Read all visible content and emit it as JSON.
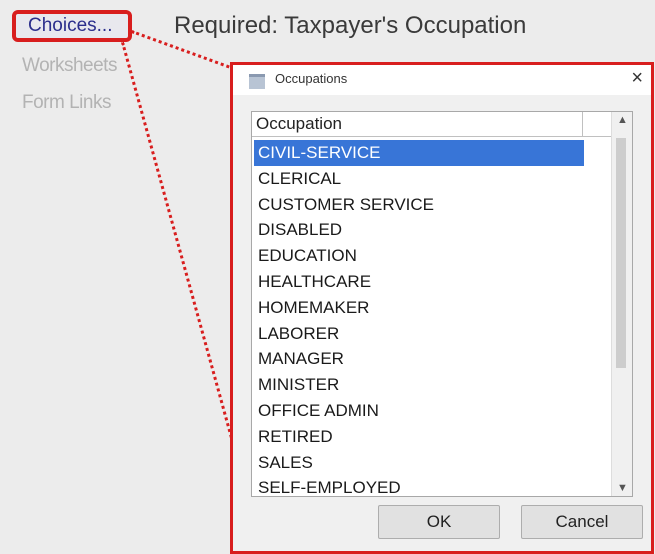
{
  "left_panel": {
    "choices_label": "Choices...",
    "worksheets_label": "Worksheets",
    "form_links_label": "Form Links"
  },
  "header": {
    "title": "Required: Taxpayer's Occupation"
  },
  "dialog": {
    "title": "Occupations",
    "close_glyph": "×",
    "column_header": "Occupation",
    "items": [
      "CIVIL-SERVICE",
      "CLERICAL",
      "CUSTOMER SERVICE",
      "DISABLED",
      "EDUCATION",
      "HEALTHCARE",
      "HOMEMAKER",
      "LABORER",
      "MANAGER",
      "MINISTER",
      "OFFICE ADMIN",
      "RETIRED",
      "SALES",
      "SELF-EMPLOYED"
    ],
    "selected_index": 0,
    "ok_label": "OK",
    "cancel_label": "Cancel"
  },
  "colors": {
    "highlight": "#d81e1e",
    "selection": "#3875d7",
    "link": "#2b2e8c"
  },
  "icons": {
    "window": "window-icon",
    "close": "close-icon",
    "scroll_up": "scroll-up-icon",
    "scroll_down": "scroll-down-icon"
  }
}
